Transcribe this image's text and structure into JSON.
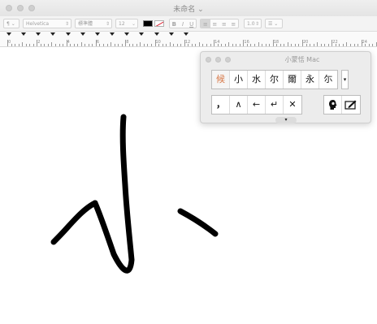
{
  "window": {
    "title": "未命名 ⌄"
  },
  "toolbar": {
    "paragraph_style": "¶ ⌄",
    "font_family": "Helvetica",
    "font_style": "標準體",
    "font_size": "12",
    "text_color": "#000000",
    "bold_label": "B",
    "italic_label": "I",
    "underline_label": "U",
    "line_spacing": "1.0",
    "list_label": "☰ ⌄"
  },
  "ruler": {
    "numbers": [
      "0",
      "2",
      "4",
      "6",
      "8",
      "10",
      "12",
      "14",
      "16",
      "18",
      "20",
      "22",
      "24"
    ]
  },
  "ime": {
    "title": "小蒙恬 Mac",
    "candidates": [
      "候",
      "小",
      "水",
      "尔",
      "爾",
      "永",
      "尓"
    ],
    "more_label": "▾",
    "keys": [
      "，",
      "∧",
      "←",
      "↵",
      "✕"
    ],
    "tools": [
      {
        "icon": "speak-icon"
      },
      {
        "icon": "handwriting-pad-icon"
      }
    ],
    "expand_label": "▾"
  },
  "colors": {
    "first_candidate": "#d87a4a",
    "ink": "#000000"
  }
}
